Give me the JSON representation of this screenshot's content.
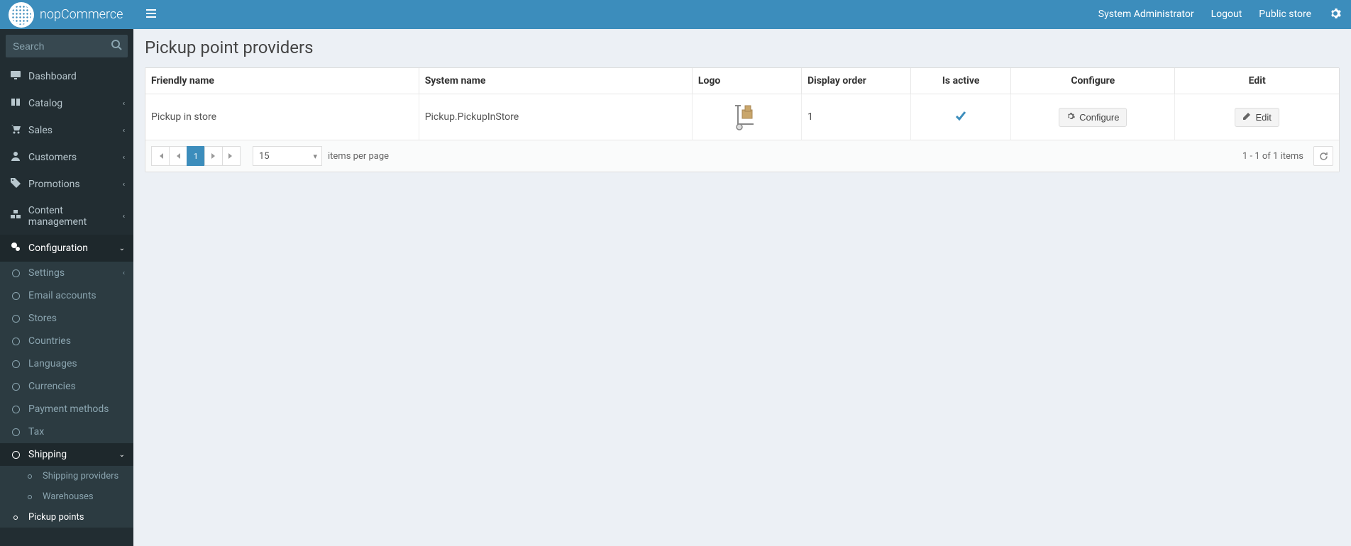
{
  "brand": "nopCommerce",
  "header": {
    "sysadmin": "System Administrator",
    "logout": "Logout",
    "public_store": "Public store"
  },
  "search": {
    "placeholder": "Search"
  },
  "sidebar": {
    "dashboard": "Dashboard",
    "catalog": "Catalog",
    "sales": "Sales",
    "customers": "Customers",
    "promotions": "Promotions",
    "content": "Content management",
    "configuration": "Configuration",
    "conf": {
      "settings": "Settings",
      "email": "Email accounts",
      "stores": "Stores",
      "countries": "Countries",
      "languages": "Languages",
      "currencies": "Currencies",
      "payment": "Payment methods",
      "tax": "Tax",
      "shipping": "Shipping",
      "ship": {
        "providers": "Shipping providers",
        "warehouses": "Warehouses",
        "pickup": "Pickup points"
      }
    }
  },
  "page": {
    "title": "Pickup point providers"
  },
  "table": {
    "headers": {
      "friendly_name": "Friendly name",
      "system_name": "System name",
      "logo": "Logo",
      "display_order": "Display order",
      "is_active": "Is active",
      "configure": "Configure",
      "edit": "Edit"
    },
    "rows": [
      {
        "friendly_name": "Pickup in store",
        "system_name": "Pickup.PickupInStore",
        "display_order": "1",
        "is_active": true,
        "configure_label": "Configure",
        "edit_label": "Edit"
      }
    ]
  },
  "pager": {
    "page": "1",
    "per_page": "15",
    "per_page_label": "items per page",
    "info": "1 - 1 of 1 items"
  }
}
